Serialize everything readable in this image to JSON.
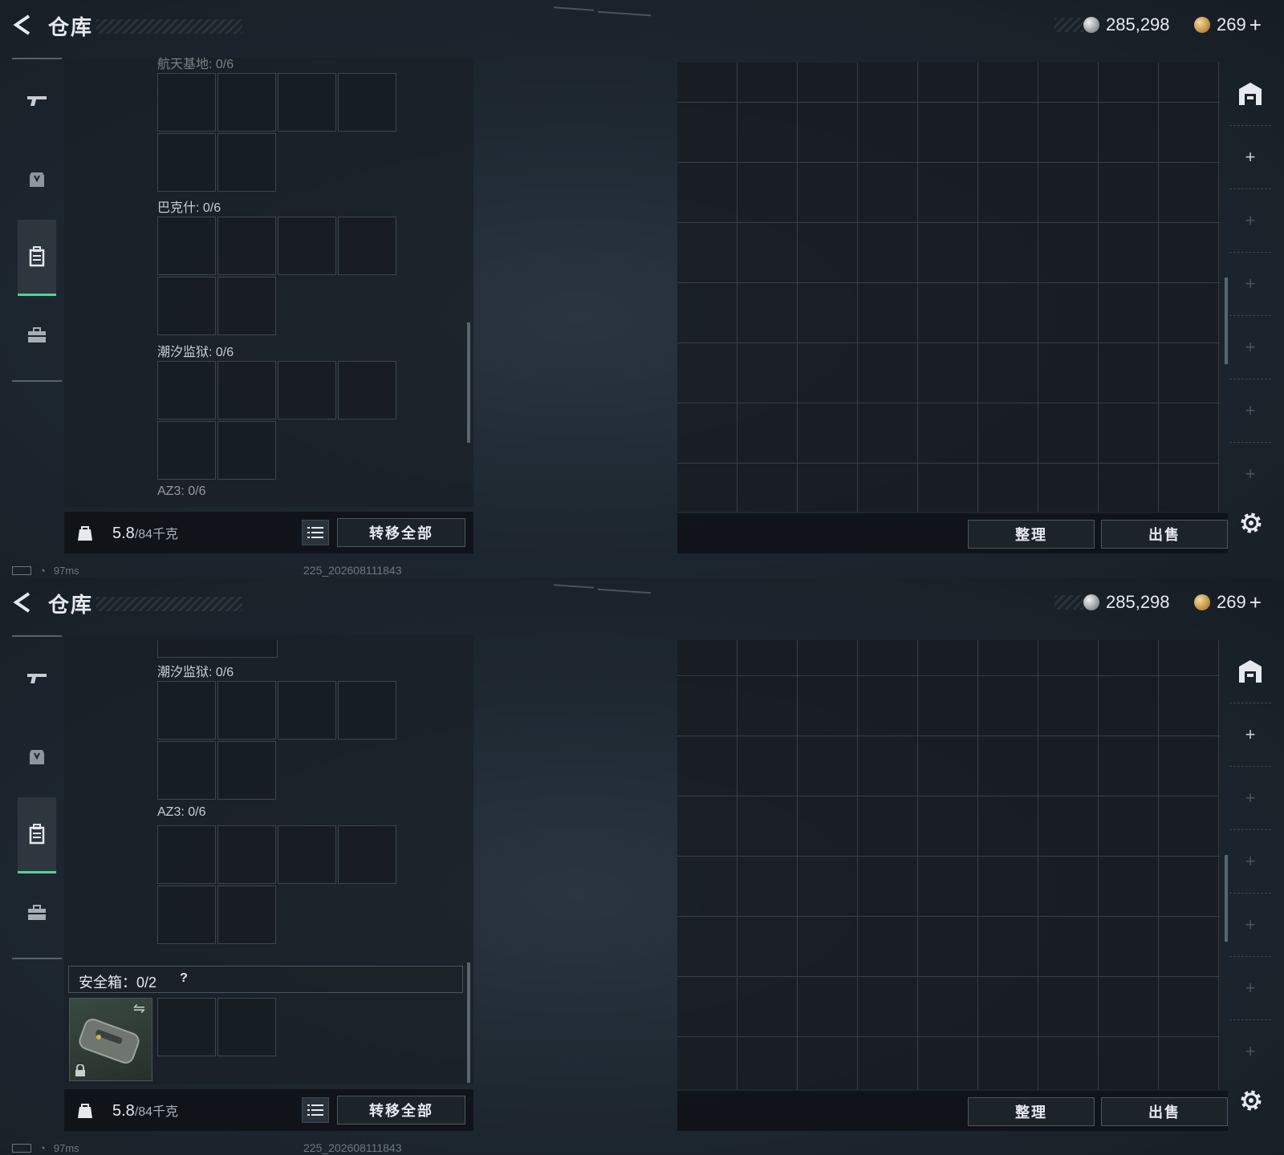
{
  "header": {
    "title": "仓库"
  },
  "currency": {
    "silver": "285,298",
    "gold": "269",
    "plus": "+"
  },
  "sidebar": {
    "items": [
      "gun-icon",
      "armor-icon",
      "backpack-icon",
      "toolbox-icon"
    ],
    "active": "backpack-icon"
  },
  "screen1": {
    "slot_labels": [
      "航天基地: 0/6",
      "巴克什: 0/6",
      "潮汐监狱: 0/6",
      "AZ3: 0/6"
    ]
  },
  "screen2": {
    "slot_labels": [
      "潮汐监狱: 0/6",
      "AZ3: 0/6"
    ],
    "safe_box": {
      "label": "安全箱：0/2",
      "help": "?"
    }
  },
  "bottom": {
    "weight_current": "5.8",
    "weight_max": "/84千克",
    "transfer_all": "转移全部"
  },
  "right": {
    "sort": "整理",
    "sell": "出售"
  },
  "status": {
    "ping": "97ms",
    "watermark": "225_202608111843"
  },
  "colors": {
    "accent": "#4fd29a",
    "background": "#1b232b"
  }
}
